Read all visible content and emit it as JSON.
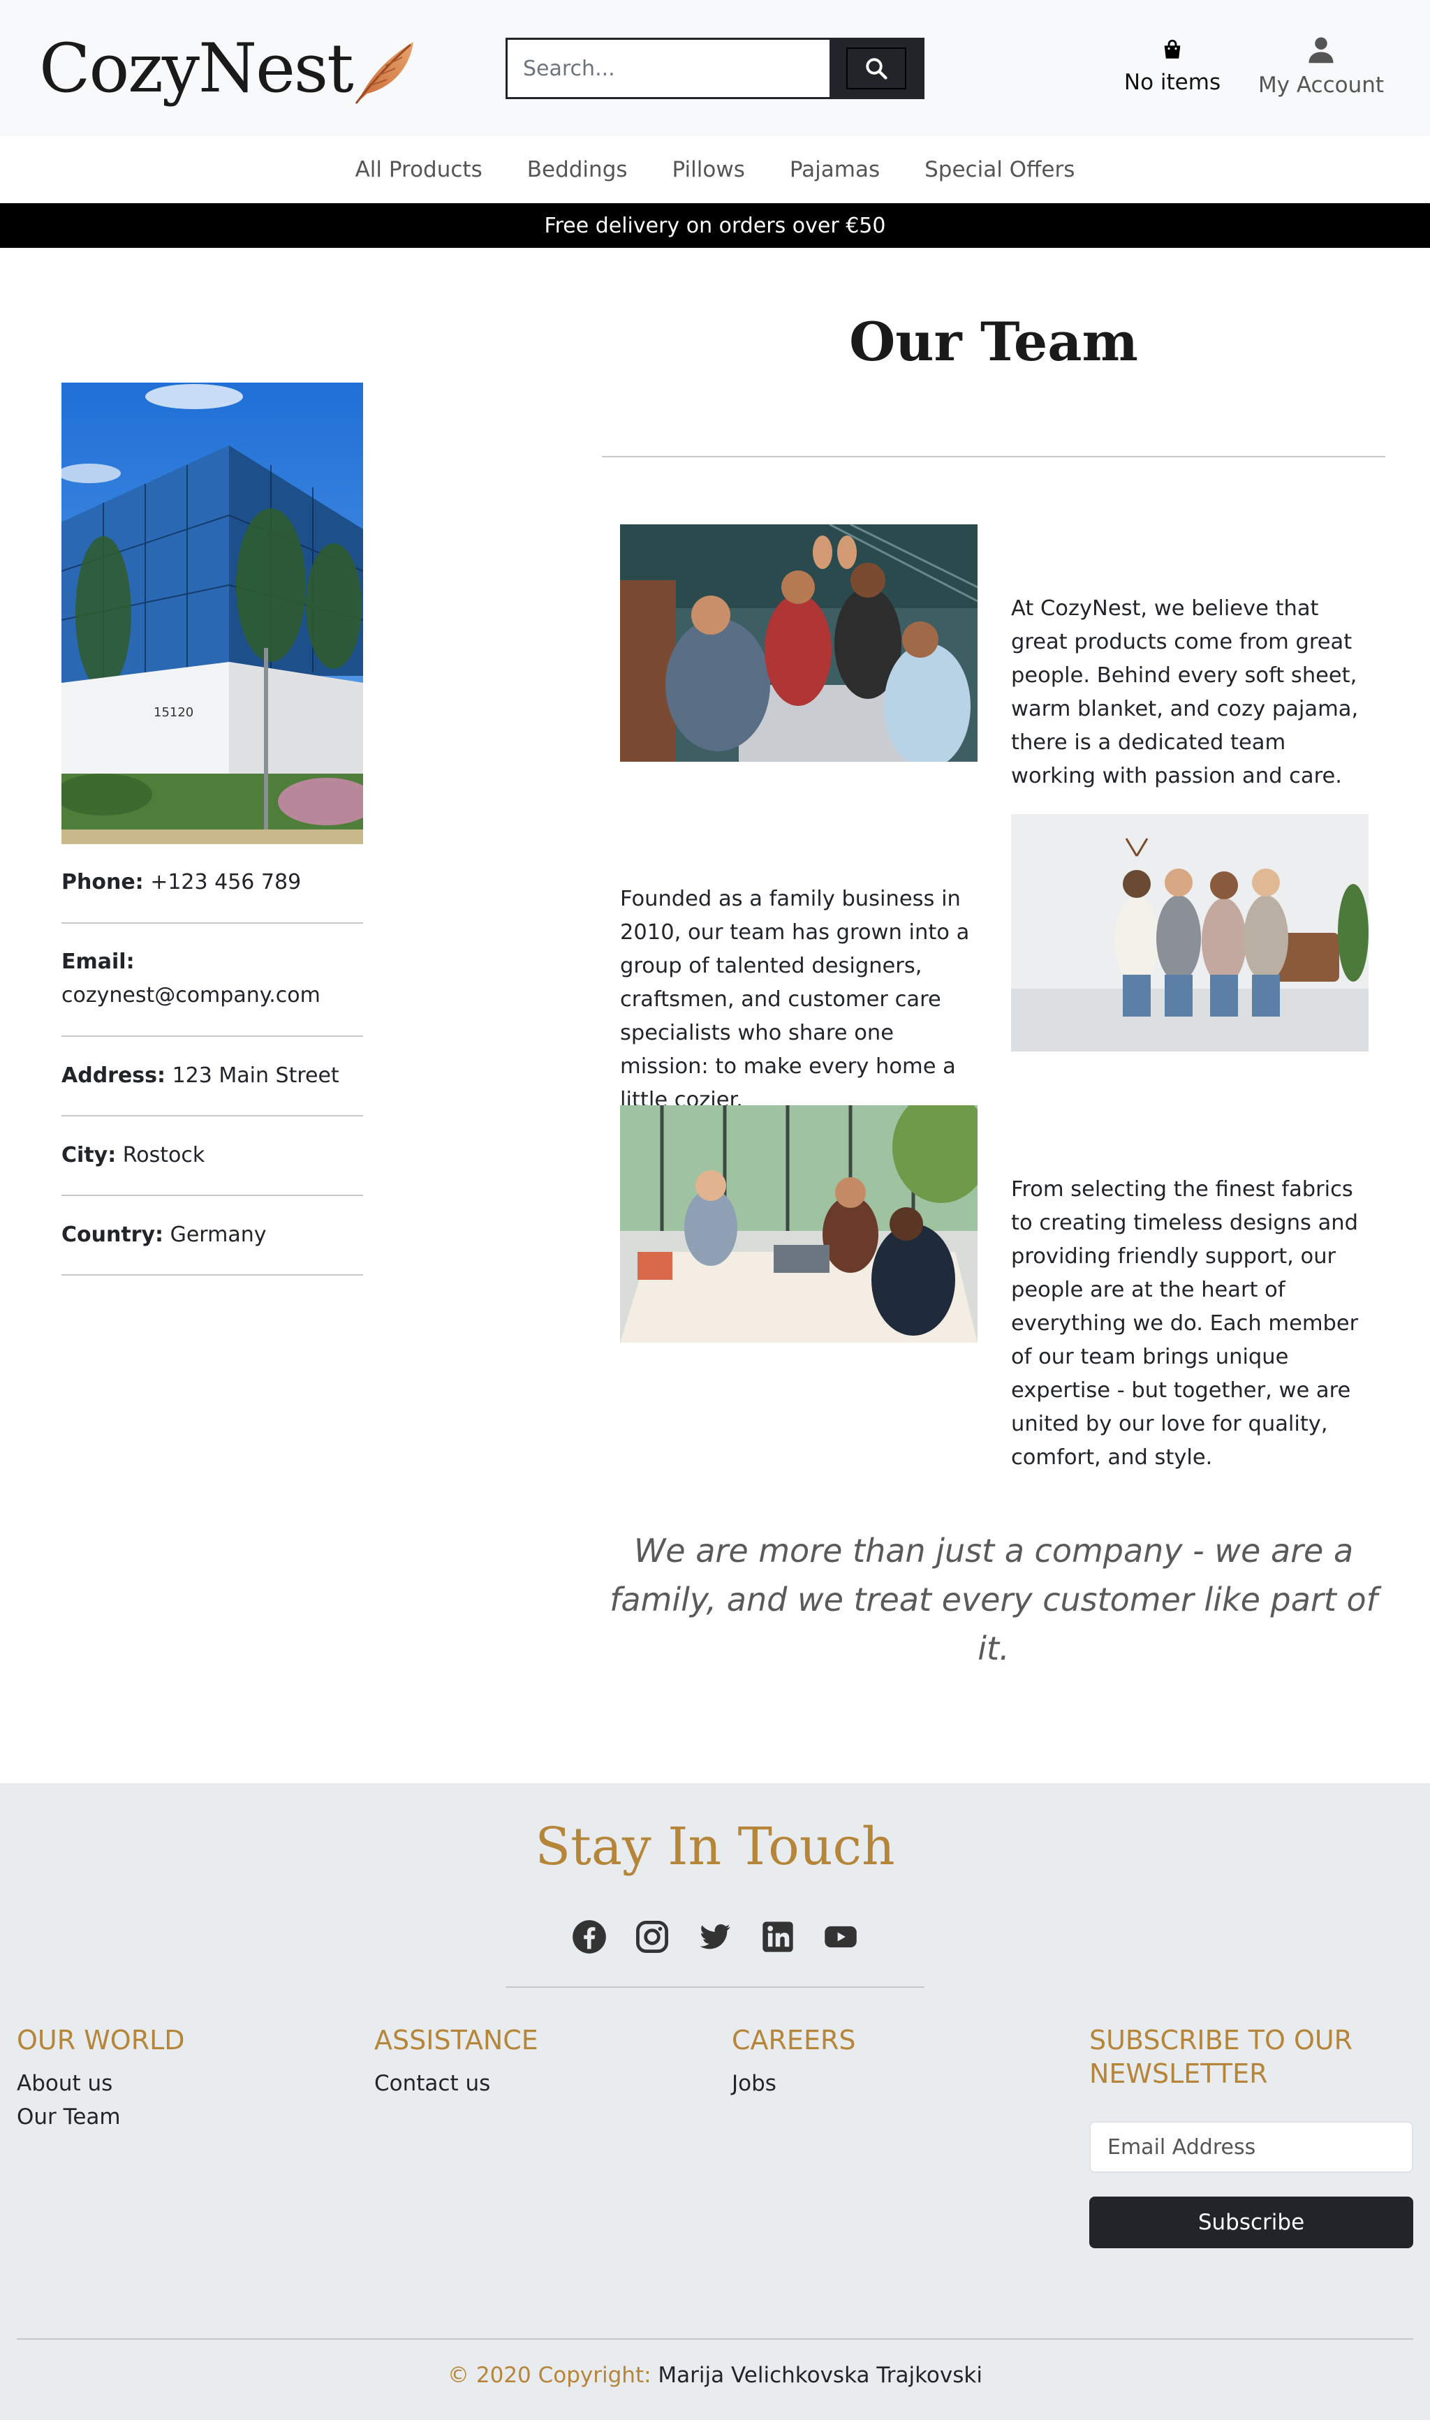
{
  "header": {
    "logo_text": "CozyNest",
    "search_placeholder": "Search...",
    "cart_label": "No items",
    "account_label": "My Account"
  },
  "nav": {
    "items": [
      {
        "label": "All Products"
      },
      {
        "label": "Beddings"
      },
      {
        "label": "Pillows"
      },
      {
        "label": "Pajamas"
      },
      {
        "label": "Special Offers"
      }
    ]
  },
  "banner": {
    "text": "Free delivery on orders over €50"
  },
  "contact": {
    "building_number": "15120",
    "phone_label": "Phone:",
    "phone": "+123 456 789",
    "email_label": "Email:",
    "email": "cozynest@company.com",
    "address_label": "Address:",
    "address": "123 Main Street",
    "city_label": "City:",
    "city": "Rostock",
    "country_label": "Country:",
    "country": "Germany"
  },
  "main": {
    "title": "Our Team",
    "paragraph_1": "At CozyNest, we believe that great products come from great people. Behind every soft sheet, warm blanket, and cozy pajama, there is a dedicated team working with passion and care.",
    "paragraph_2": "Founded as a family business in 2010, our team has grown into a group of talented designers, craftsmen, and customer care specialists who share one mission: to make every home a little cozier.",
    "paragraph_3": "From selecting the finest fabrics to creating timeless designs and providing friendly support, our people are at the heart of everything we do. Each member of our team brings unique expertise - but together, we are united by our love for quality, comfort, and style.",
    "quote": "We are more than just a company - we are a family, and we treat every customer like part of it."
  },
  "footer": {
    "stay_title": "Stay In Touch",
    "socials": [
      "facebook-icon",
      "instagram-icon",
      "twitter-icon",
      "linkedin-icon",
      "youtube-icon"
    ],
    "col1": {
      "heading": "OUR WORLD",
      "links": [
        "About us",
        "Our Team"
      ]
    },
    "col2": {
      "heading": "ASSISTANCE",
      "links": [
        "Contact us"
      ]
    },
    "col3": {
      "heading": "CAREERS",
      "links": [
        "Jobs"
      ]
    },
    "col4": {
      "heading": "SUBSCRIBE TO OUR NEWSLETTER",
      "email_placeholder": "Email Address",
      "button": "Subscribe"
    },
    "copyright_prefix": "© 2020 Copyright:",
    "copyright_name": "Marija Velichkovska Trajkovski"
  },
  "colors": {
    "accent": "#b5853a",
    "dark": "#212529",
    "banner": "#000000",
    "footer_bg": "#e9ecef"
  }
}
